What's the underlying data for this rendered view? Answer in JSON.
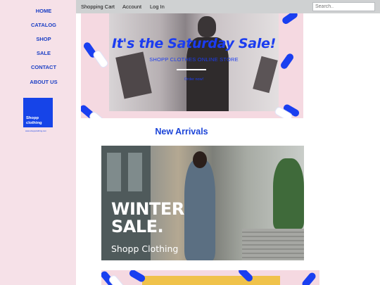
{
  "sidebar": {
    "items": [
      {
        "label": "HOME"
      },
      {
        "label": "CATALOG"
      },
      {
        "label": "SHOP"
      },
      {
        "label": "SALE"
      },
      {
        "label": "CONTACT"
      },
      {
        "label": "ABOUT US"
      }
    ],
    "logo": {
      "line1": "Shopp",
      "line2": "clothing",
      "caption": "www.shoppclothing.com"
    }
  },
  "topbar": {
    "links": [
      {
        "label": "Shopping Cart"
      },
      {
        "label": "Account"
      },
      {
        "label": "Log In"
      }
    ],
    "search": {
      "placeholder": "Search.."
    }
  },
  "banner_sale": {
    "title": "It's the Saturday Sale!",
    "subtitle": "SHOPP CLOTHES ONLINE STORE",
    "cta": "Order now!"
  },
  "new_arrivals": {
    "title": "New Arrivals"
  },
  "banner_winter": {
    "line1": "WINTER",
    "line2": "SALE.",
    "brand": "Shopp Clothing"
  },
  "colors": {
    "accent": "#1b3cf0",
    "sidebar_bg": "#f6e1e8",
    "topbar_bg": "#cfd1d2"
  }
}
